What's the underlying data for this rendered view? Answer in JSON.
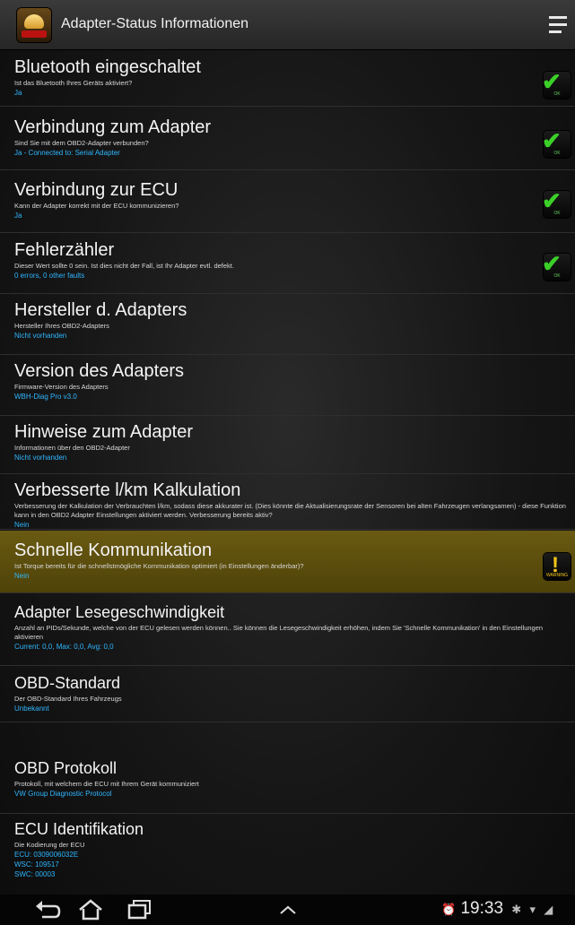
{
  "header": {
    "title": "Adapter-Status Informationen",
    "app_icon": "torque-app-icon",
    "menu_icon": "overflow-menu-icon"
  },
  "items": [
    {
      "heading": "Bluetooth eingeschaltet",
      "desc": "Ist das Bluetooth Ihres Geräts aktiviert?",
      "value": "Ja",
      "icon": "ok"
    },
    {
      "heading": "Verbindung zum Adapter",
      "desc": "Sind Sie mit dem OBD2-Adapter verbunden?",
      "value": "Ja - Connected to: Serial Adapter",
      "icon": "ok"
    },
    {
      "heading": "Verbindung zur ECU",
      "desc": "Kann der Adapter korrekt mit der ECU kommunizieren?",
      "value": "Ja",
      "icon": "ok"
    },
    {
      "heading": "Fehlerzähler",
      "desc": "Dieser Wert sollte 0 sein. Ist dies nicht der Fall, ist Ihr Adapter evtl. defekt.",
      "value": "0 errors, 0 other faults",
      "icon": "ok"
    },
    {
      "heading": "Hersteller d. Adapters",
      "desc": "Hersteller Ihres OBD2-Adapters",
      "value": "Nicht vorhanden"
    },
    {
      "heading": "Version des Adapters",
      "desc": "Firmware-Version des Adapters",
      "value": "WBH-Diag Pro v3.0"
    },
    {
      "heading": "Hinweise zum Adapter",
      "desc": "Informationen über den OBD2-Adapter",
      "value": "Nicht vorhanden"
    },
    {
      "heading": "Verbesserte l/km Kalkulation",
      "desc": "Verbesserung der Kalkulation der Verbrauchten l/km, sodass diese akkurater ist. (Dies könnte die Aktualisierungsrate der Sensoren bei alten Fahrzeugen verlangsamen) - diese Funktion kann in den OBD2 Adapter Einstellungen aktiviert werden. Verbesserung bereits aktiv?",
      "value": "Nein"
    },
    {
      "heading": "Schnelle Kommunikation",
      "desc": "Ist Torque bereits für die schnellstmögliche Kommunikation optimiert (in Einstellungen änderbar)?",
      "value": "Nein",
      "icon": "warning"
    },
    {
      "heading": "Adapter Lesegeschwindigkeit",
      "desc": "Anzahl an PIDs/Sekunde, welche von der ECU gelesen werden können.. Sie können die Lesegeschwindigkeit erhöhen, indem Sie 'Schnelle Kommunikation' in den Einstellungen aktivieren",
      "value": "Current: 0,0, Max: 0,0, Avg: 0,0"
    },
    {
      "heading": "OBD-Standard",
      "desc": "Der OBD-Standard Ihres Fahrzeugs",
      "value": "Unbekannt"
    },
    {
      "heading": "OBD Protokoll",
      "desc": "Protokoll, mit welchem die ECU mit Ihrem Gerät kommuniziert",
      "value": "VW Group Diagnostic Protocol"
    },
    {
      "heading": "ECU Identifikation",
      "desc": "Die Kodierung der ECU",
      "value": "ECU: 0309006032E",
      "value2": "WSC: 109517",
      "value3": "SWC: 00003"
    }
  ],
  "badges": {
    "ok_label": "OK",
    "warning_label": "WARNING"
  },
  "navbar": {
    "back_icon": "back-icon",
    "home_icon": "home-icon",
    "recents_icon": "recent-apps-icon",
    "up_icon": "chevron-up-icon",
    "time": "19:33"
  }
}
